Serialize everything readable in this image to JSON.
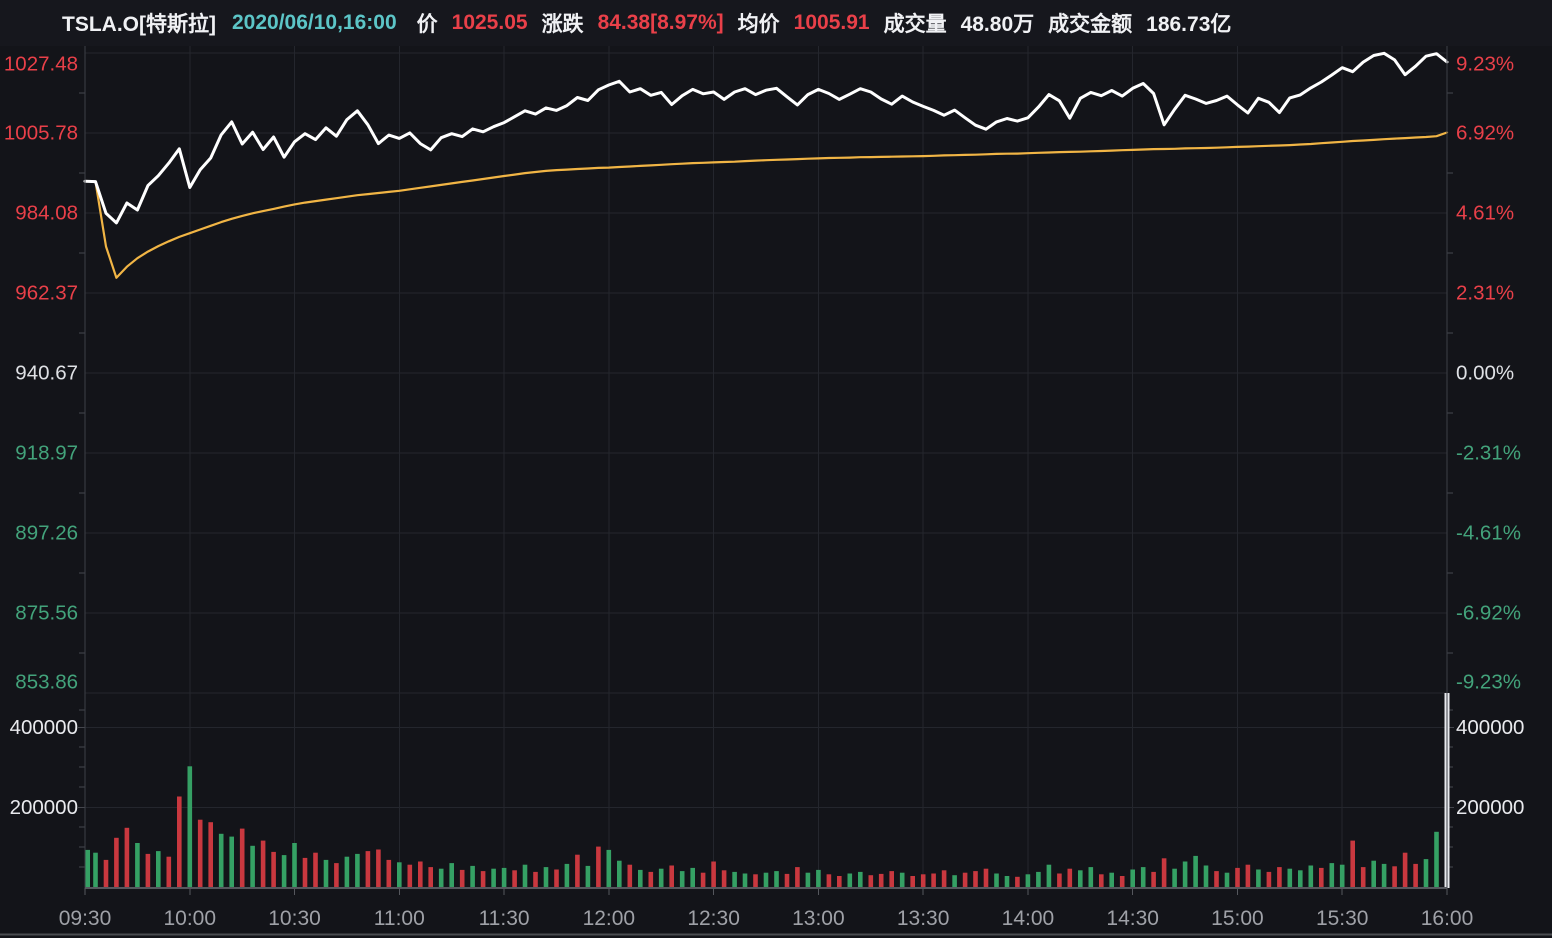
{
  "header": {
    "symbol": "TSLA.O[特斯拉]",
    "datetime": "2020/06/10,16:00",
    "price_label": "价",
    "price": "1025.05",
    "change_label": "涨跌",
    "change": "84.38[8.97%]",
    "avg_label": "均价",
    "avg": "1005.91",
    "volume_label": "成交量",
    "volume": "48.80万",
    "amount_label": "成交金额",
    "amount": "186.73亿"
  },
  "colors": {
    "background": "#131419",
    "header_background": "#16171d",
    "red": "#e94049",
    "green": "#43a37b",
    "white_text": "#e9eaee",
    "neutral_text": "#dfe1e5",
    "gray_text": "#9fa1a7",
    "cyan": "#5cc5c7",
    "price_line": "#ffffff",
    "avg_line": "#f1b545",
    "bar_red": "#c9383f",
    "bar_green": "#35a064",
    "bar_white": "#e7e9ed",
    "grid": "#24262d",
    "axis": "#45474e",
    "baseline": "#55575d"
  },
  "chart_data": {
    "type": "line",
    "title": "TSLA.O intraday price / avg-price / volume",
    "x_axis": {
      "ticks": [
        "09:30",
        "10:00",
        "10:30",
        "11:00",
        "11:30",
        "12:00",
        "12:30",
        "13:00",
        "13:30",
        "14:00",
        "14:30",
        "15:00",
        "15:30",
        "16:00"
      ],
      "session_minutes": 390
    },
    "price_axis": {
      "labels": [
        "1027.48",
        "1005.78",
        "984.08",
        "962.37",
        "940.67",
        "918.97",
        "897.26",
        "875.56",
        "853.86"
      ],
      "prev_close": 940.67,
      "max": 1027.48,
      "min": 853.86
    },
    "pct_axis": {
      "labels": [
        "9.23%",
        "6.92%",
        "4.61%",
        "2.31%",
        "0.00%",
        "-2.31%",
        "-4.61%",
        "-6.92%",
        "-9.23%"
      ]
    },
    "volume_axis": {
      "labels": [
        "400000",
        "200000"
      ],
      "values": [
        400000,
        200000
      ],
      "pane_max": 485000
    },
    "sample_interval_min": 3,
    "series": [
      {
        "name": "price",
        "color": "#ffffff",
        "values": [
          992.7,
          992.6,
          984.0,
          981.4,
          986.8,
          984.9,
          991.5,
          994.2,
          997.6,
          1001.5,
          991.0,
          995.8,
          999.0,
          1005.3,
          1008.8,
          1002.8,
          1006.0,
          1001.3,
          1004.7,
          999.2,
          1003.4,
          1005.6,
          1004.0,
          1007.2,
          1004.9,
          1009.4,
          1011.8,
          1008.0,
          1002.9,
          1005.2,
          1004.3,
          1005.8,
          1002.9,
          1001.2,
          1004.5,
          1005.6,
          1004.8,
          1006.9,
          1006.1,
          1007.5,
          1008.6,
          1010.2,
          1011.8,
          1010.9,
          1012.6,
          1011.9,
          1013.2,
          1015.4,
          1014.6,
          1017.5,
          1018.8,
          1019.8,
          1016.9,
          1017.8,
          1016.0,
          1016.8,
          1013.5,
          1015.9,
          1017.6,
          1016.4,
          1016.9,
          1014.9,
          1016.9,
          1017.8,
          1016.2,
          1017.4,
          1017.9,
          1015.6,
          1013.4,
          1016.2,
          1017.6,
          1016.5,
          1014.9,
          1016.3,
          1017.8,
          1016.9,
          1015.0,
          1013.6,
          1015.8,
          1014.2,
          1013.0,
          1011.9,
          1010.6,
          1012.0,
          1009.9,
          1007.9,
          1006.8,
          1008.8,
          1009.7,
          1009.0,
          1009.9,
          1012.8,
          1016.2,
          1014.5,
          1009.8,
          1015.2,
          1016.8,
          1015.9,
          1017.3,
          1015.8,
          1017.9,
          1019.2,
          1016.5,
          1008.0,
          1012.2,
          1016.0,
          1015.0,
          1013.8,
          1014.6,
          1015.8,
          1013.4,
          1011.2,
          1015.2,
          1014.1,
          1011.3,
          1015.3,
          1016.1,
          1018.0,
          1019.6,
          1021.5,
          1023.5,
          1022.4,
          1025.0,
          1026.8,
          1027.4,
          1025.6,
          1021.6,
          1023.9,
          1026.6,
          1027.3,
          1025.05
        ]
      },
      {
        "name": "avg_price",
        "color": "#f1b545",
        "values": [
          992.7,
          992.6,
          975.0,
          966.5,
          969.5,
          971.8,
          973.6,
          975.1,
          976.4,
          977.6,
          978.6,
          979.6,
          980.6,
          981.6,
          982.5,
          983.3,
          984.0,
          984.6,
          985.2,
          985.8,
          986.4,
          986.9,
          987.3,
          987.7,
          988.1,
          988.5,
          988.9,
          989.2,
          989.5,
          989.8,
          990.1,
          990.5,
          990.9,
          991.3,
          991.7,
          992.1,
          992.5,
          992.9,
          993.3,
          993.7,
          994.1,
          994.5,
          994.9,
          995.2,
          995.5,
          995.7,
          995.85,
          996.0,
          996.15,
          996.3,
          996.4,
          996.55,
          996.7,
          996.85,
          997.0,
          997.15,
          997.3,
          997.45,
          997.6,
          997.7,
          997.8,
          997.9,
          998.0,
          998.15,
          998.3,
          998.4,
          998.5,
          998.6,
          998.7,
          998.8,
          998.9,
          999.0,
          999.05,
          999.1,
          999.2,
          999.25,
          999.3,
          999.35,
          999.4,
          999.45,
          999.5,
          999.6,
          999.7,
          999.75,
          999.85,
          999.9,
          1000.0,
          1000.1,
          1000.15,
          1000.2,
          1000.3,
          1000.4,
          1000.5,
          1000.6,
          1000.65,
          1000.7,
          1000.8,
          1000.9,
          1001.0,
          1001.1,
          1001.2,
          1001.3,
          1001.4,
          1001.45,
          1001.5,
          1001.6,
          1001.65,
          1001.7,
          1001.8,
          1001.9,
          1002.0,
          1002.1,
          1002.2,
          1002.3,
          1002.4,
          1002.5,
          1002.65,
          1002.8,
          1003.0,
          1003.2,
          1003.4,
          1003.6,
          1003.75,
          1003.9,
          1004.1,
          1004.25,
          1004.4,
          1004.55,
          1004.7,
          1004.9,
          1005.91
        ]
      }
    ],
    "volume": {
      "name": "volume",
      "values": [
        95000,
        88000,
        70000,
        125000,
        150000,
        112000,
        85000,
        92000,
        78000,
        228000,
        303000,
        170000,
        164000,
        135000,
        128000,
        148000,
        105000,
        118000,
        90000,
        82000,
        112000,
        75000,
        88000,
        70000,
        62000,
        78000,
        85000,
        92000,
        96000,
        70000,
        64000,
        58000,
        66000,
        52000,
        48000,
        62000,
        45000,
        55000,
        42000,
        48000,
        50000,
        44000,
        58000,
        40000,
        52000,
        46000,
        60000,
        83000,
        55000,
        103000,
        95000,
        68000,
        58000,
        45000,
        40000,
        48000,
        56000,
        42000,
        50000,
        38000,
        66000,
        44000,
        40000,
        36000,
        34000,
        38000,
        42000,
        35000,
        52000,
        38000,
        45000,
        34000,
        30000,
        36000,
        40000,
        32000,
        35000,
        42000,
        38000,
        30000,
        34000,
        36000,
        44000,
        32000,
        38000,
        42000,
        48000,
        36000,
        30000,
        28000,
        34000,
        40000,
        58000,
        36000,
        48000,
        44000,
        52000,
        34000,
        38000,
        30000,
        46000,
        52000,
        40000,
        74000,
        48000,
        66000,
        80000,
        56000,
        42000,
        38000,
        50000,
        58000,
        46000,
        40000,
        52000,
        48000,
        44000,
        56000,
        50000,
        62000,
        58000,
        118000,
        52000,
        68000,
        60000,
        54000,
        88000,
        60000,
        72000,
        140000,
        488000
      ],
      "color_key": "ggrrrgrgrrgrrggrgrrggrrgrggrrrgrrrggrgrggrgrgrgrgrggrgrgrggrrrggrggrrggrrggrrrgrrrrgrrrggrgggrrggrgrggrrggggrgrrgrrgggrggrrggrrrggw"
    }
  }
}
